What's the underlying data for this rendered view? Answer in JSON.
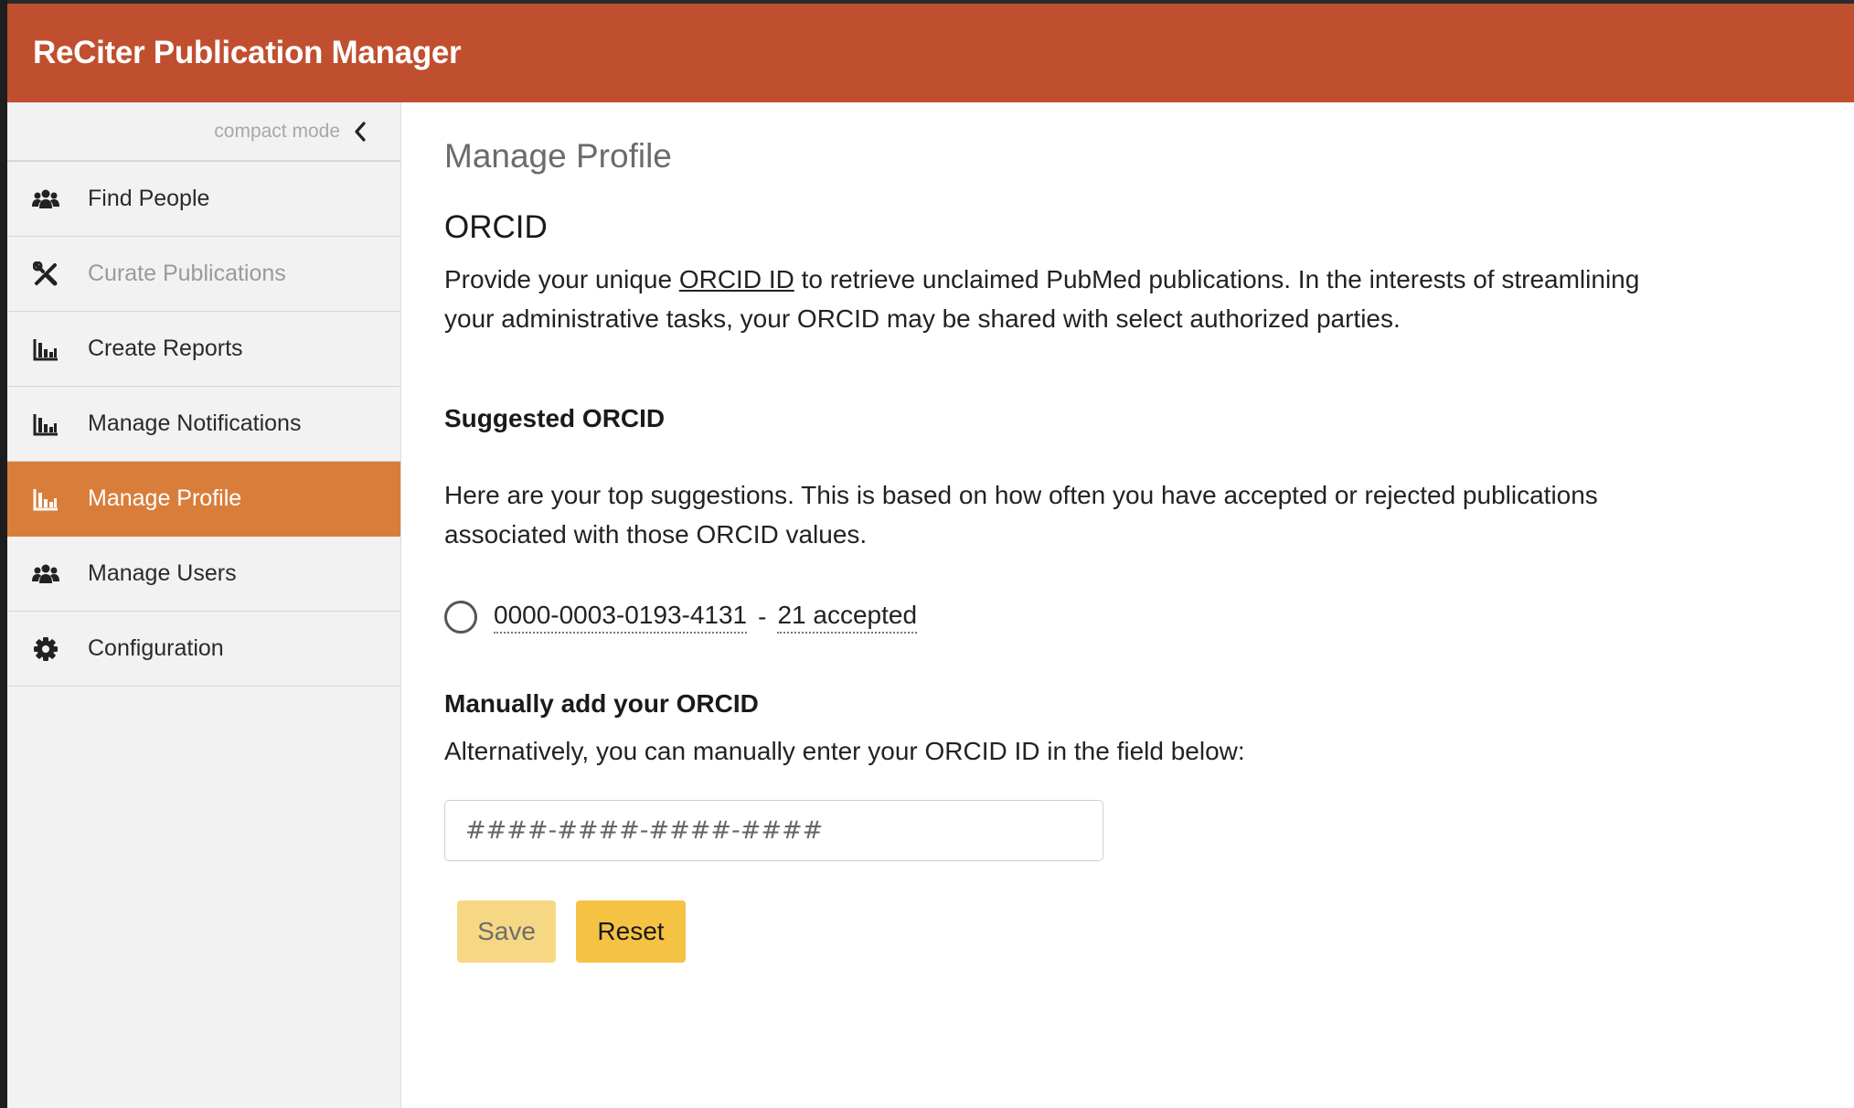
{
  "app": {
    "title": "ReCiter Publication Manager",
    "colors": {
      "header": "#c04f2f",
      "active_nav": "#d97d3a",
      "save": "#f6d784",
      "reset": "#f5c243"
    }
  },
  "sidebar": {
    "compact_label": "compact mode",
    "items": [
      {
        "label": "Find People",
        "icon": "users-icon"
      },
      {
        "label": "Curate Publications",
        "icon": "tools-icon",
        "disabled": true
      },
      {
        "label": "Create Reports",
        "icon": "bar-chart-icon"
      },
      {
        "label": "Manage Notifications",
        "icon": "bar-chart-icon"
      },
      {
        "label": "Manage Profile",
        "icon": "bar-chart-icon",
        "active": true
      },
      {
        "label": "Manage Users",
        "icon": "users-icon"
      },
      {
        "label": "Configuration",
        "icon": "gear-icon"
      }
    ]
  },
  "main": {
    "page_title": "Manage Profile",
    "orcid_heading": "ORCID",
    "intro_before": "Provide your unique ",
    "intro_link": "ORCID ID",
    "intro_after": " to retrieve unclaimed PubMed publications. In the interests of streamlining your administrative tasks, your ORCID may be shared with select authorized parties.",
    "suggested_heading": "Suggested ORCID",
    "suggested_text": "Here are your top suggestions. This is based on how often you have accepted or rejected publications associated with those ORCID values.",
    "suggestion": {
      "orcid": "0000-0003-0193-4131",
      "separator": "-",
      "count": "21 accepted"
    },
    "manual_heading": "Manually add your ORCID",
    "manual_text": "Alternatively, you can manually enter your ORCID ID in the field below:",
    "input_placeholder": "####-####-####-####",
    "save_label": "Save",
    "reset_label": "Reset"
  }
}
